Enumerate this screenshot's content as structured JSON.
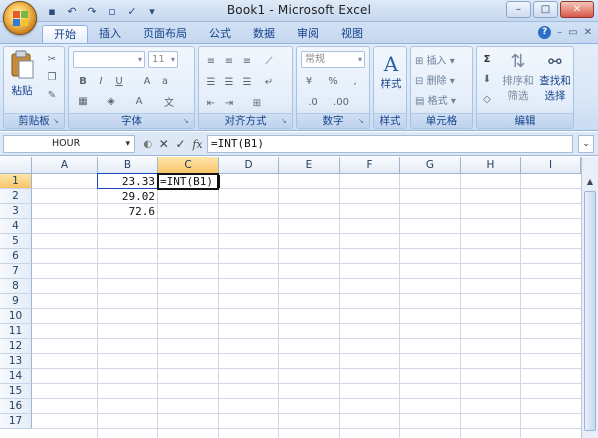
{
  "window": {
    "title": "Book1 - Microsoft Excel",
    "controls": [
      "–",
      "□",
      "✕"
    ]
  },
  "ribbon": {
    "tabs": [
      "开始",
      "插入",
      "页面布局",
      "公式",
      "数据",
      "审阅",
      "视图"
    ],
    "active_tab": "开始",
    "groups": {
      "clipboard": {
        "label": "剪贴板",
        "paste": "粘贴"
      },
      "font": {
        "label": "字体",
        "font_size": "11"
      },
      "alignment": {
        "label": "对齐方式"
      },
      "number": {
        "label": "数字",
        "format": "常规",
        "percent": "%"
      },
      "styles": {
        "label": "样式",
        "big": "样式",
        "icon_letter": "A"
      },
      "cells": {
        "label": "单元格",
        "insert": "插入",
        "delete": "删除",
        "format": "格式"
      },
      "editing": {
        "label": "编辑",
        "sort": "排序和",
        "sort2": "筛选",
        "find": "查找和",
        "find2": "选择"
      }
    }
  },
  "formula_bar": {
    "name_box": "HOUR",
    "formula": "=INT(B1)",
    "fx": "fx"
  },
  "sheet": {
    "columns": [
      "A",
      "B",
      "C",
      "D",
      "E",
      "F",
      "G",
      "H",
      "I"
    ],
    "selected_column": "C",
    "rows": [
      "1",
      "2",
      "3",
      "4",
      "5",
      "6",
      "7",
      "8",
      "9",
      "10",
      "11",
      "12",
      "13",
      "14",
      "15",
      "16",
      "17"
    ],
    "selected_row": "1",
    "cells": {
      "B1": "23.33",
      "B2": "29.02",
      "B3": "72.6",
      "C1": "=INT(B1)"
    }
  },
  "colors": {
    "ribbon_bg": "#dbe7f7",
    "selection_header": "#f7c46b",
    "ref_border": "#1f4bb8"
  }
}
